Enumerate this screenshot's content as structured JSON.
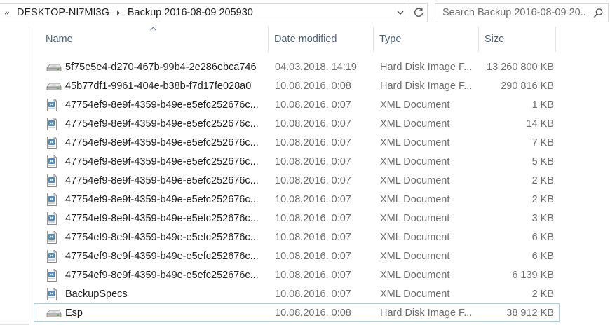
{
  "address": {
    "overflow": "«",
    "crumbs": [
      "DESKTOP-NI7MI3G",
      "Backup 2016-08-09 205930"
    ]
  },
  "search": {
    "placeholder": "Search Backup 2016-08-09 20..."
  },
  "columns": {
    "name": "Name",
    "date": "Date modified",
    "type": "Type",
    "size": "Size"
  },
  "files": [
    {
      "name": "5f75e5e4-d270-467b-99b4-2e286ebca746",
      "date": "04.03.2018. 14:19",
      "type": "Hard Disk Image F...",
      "size": "13 260 800 KB",
      "icon": "disk-image-icon"
    },
    {
      "name": "45b77df1-9961-404e-b38b-f7d17fe028a0",
      "date": "10.08.2016. 0:08",
      "type": "Hard Disk Image F...",
      "size": "290 816 KB",
      "icon": "disk-image-icon"
    },
    {
      "name": "47754ef9-8e9f-4359-b49e-e5efc252676c...",
      "date": "10.08.2016. 0:07",
      "type": "XML Document",
      "size": "1 KB",
      "icon": "xml-document-icon"
    },
    {
      "name": "47754ef9-8e9f-4359-b49e-e5efc252676c...",
      "date": "10.08.2016. 0:07",
      "type": "XML Document",
      "size": "14 KB",
      "icon": "xml-document-icon"
    },
    {
      "name": "47754ef9-8e9f-4359-b49e-e5efc252676c...",
      "date": "10.08.2016. 0:07",
      "type": "XML Document",
      "size": "7 KB",
      "icon": "xml-document-icon"
    },
    {
      "name": "47754ef9-8e9f-4359-b49e-e5efc252676c...",
      "date": "10.08.2016. 0:07",
      "type": "XML Document",
      "size": "5 KB",
      "icon": "xml-document-icon"
    },
    {
      "name": "47754ef9-8e9f-4359-b49e-e5efc252676c...",
      "date": "10.08.2016. 0:07",
      "type": "XML Document",
      "size": "2 KB",
      "icon": "xml-document-icon"
    },
    {
      "name": "47754ef9-8e9f-4359-b49e-e5efc252676c...",
      "date": "10.08.2016. 0:07",
      "type": "XML Document",
      "size": "2 KB",
      "icon": "xml-document-icon"
    },
    {
      "name": "47754ef9-8e9f-4359-b49e-e5efc252676c...",
      "date": "10.08.2016. 0:07",
      "type": "XML Document",
      "size": "3 KB",
      "icon": "xml-document-icon"
    },
    {
      "name": "47754ef9-8e9f-4359-b49e-e5efc252676c...",
      "date": "10.08.2016. 0:07",
      "type": "XML Document",
      "size": "6 KB",
      "icon": "xml-document-icon"
    },
    {
      "name": "47754ef9-8e9f-4359-b49e-e5efc252676c...",
      "date": "10.08.2016. 0:07",
      "type": "XML Document",
      "size": "6 KB",
      "icon": "xml-document-icon"
    },
    {
      "name": "47754ef9-8e9f-4359-b49e-e5efc252676c...",
      "date": "10.08.2016. 0:07",
      "type": "XML Document",
      "size": "6 139 KB",
      "icon": "xml-document-icon"
    },
    {
      "name": "BackupSpecs",
      "date": "10.08.2016. 0:07",
      "type": "XML Document",
      "size": "2 KB",
      "icon": "xml-document-icon"
    },
    {
      "name": "Esp",
      "date": "10.08.2016. 0:08",
      "type": "Hard Disk Image F...",
      "size": "38 912 KB",
      "icon": "disk-image-icon",
      "selected": true
    }
  ],
  "colors": {
    "header_text": "#4c607a",
    "selection_border": "#99d1ff",
    "secondary_text": "#6d6d6d"
  }
}
